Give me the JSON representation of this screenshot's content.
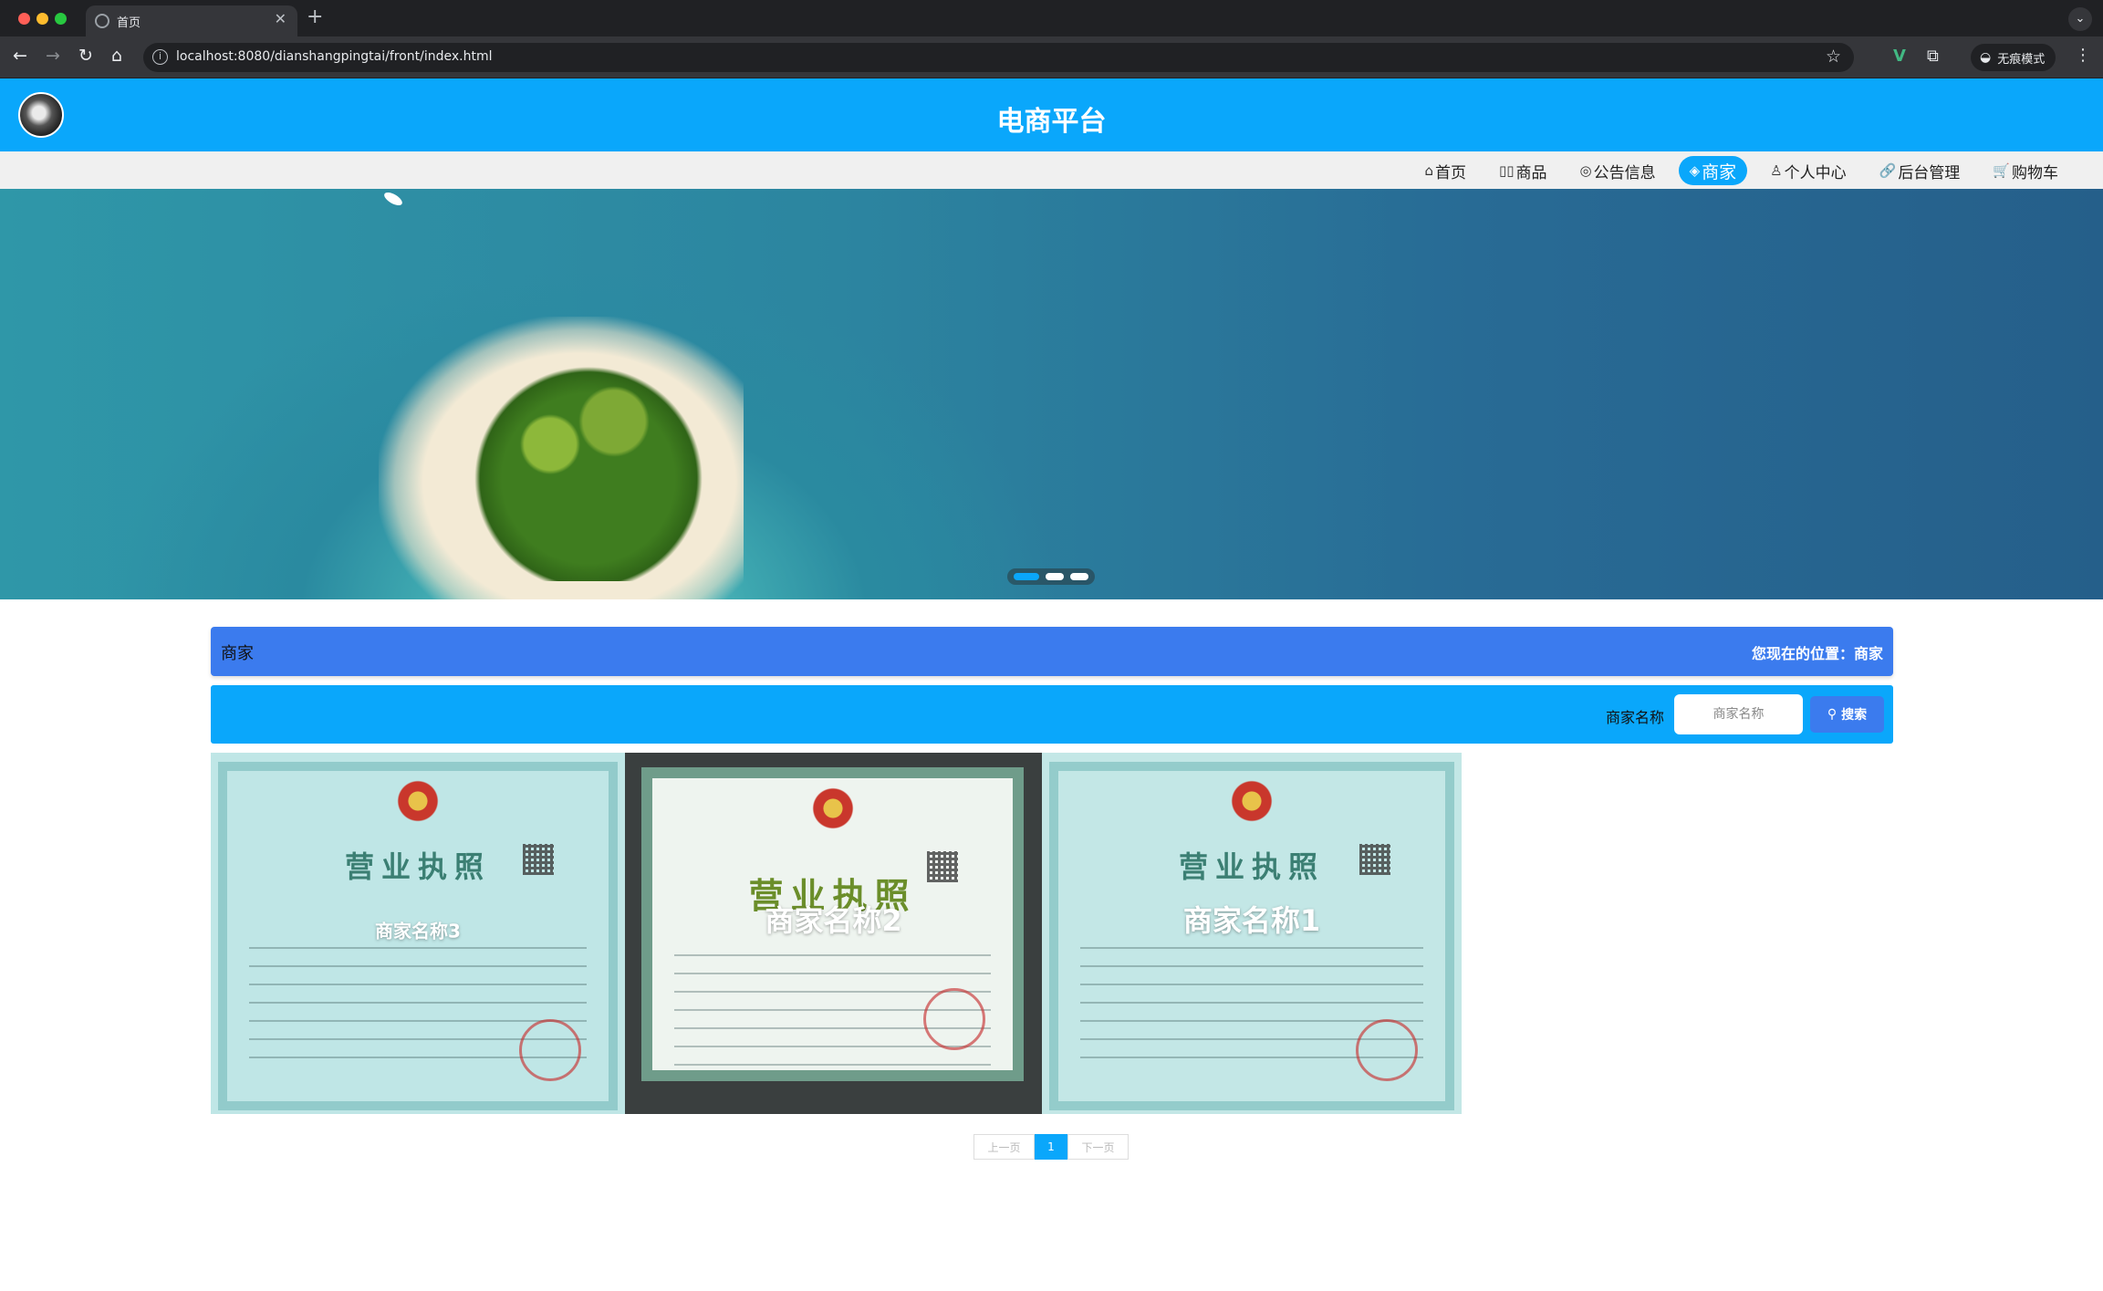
{
  "browser": {
    "tab_title": "首页",
    "tab_close": "✕",
    "new_tab": "+",
    "url": "localhost:8080/dianshangpingtai/front/index.html",
    "incognito_label": "无痕模式",
    "icons": [
      "back-icon",
      "forward-icon",
      "reload-icon",
      "home-icon",
      "info-icon",
      "star-icon",
      "vue-devtools-icon",
      "extensions-icon",
      "incognito-icon",
      "menu-icon"
    ]
  },
  "header": {
    "title": "电商平台"
  },
  "nav": {
    "items": [
      {
        "icon": "⌂",
        "label": "首页"
      },
      {
        "icon": "▯▯",
        "label": "商品"
      },
      {
        "icon": "◎",
        "label": "公告信息"
      },
      {
        "icon": "◈",
        "label": "商家",
        "active": true
      },
      {
        "icon": "♙",
        "label": "个人中心"
      },
      {
        "icon": "🔗",
        "label": "后台管理"
      },
      {
        "icon": "🛒",
        "label": "购物车"
      }
    ]
  },
  "banner": {
    "slide_count": 3,
    "active_slide": 1
  },
  "breadcrumb": {
    "title": "商家",
    "location": "您现在的位置：商家"
  },
  "search": {
    "label": "商家名称",
    "placeholder": "商家名称",
    "button_label": "搜索"
  },
  "merchants": [
    {
      "name": "商家名称3",
      "heading": "营业执照"
    },
    {
      "name": "商家名称2",
      "heading": "营业执照"
    },
    {
      "name": "商家名称1",
      "heading": "营业执照"
    }
  ],
  "pagination": {
    "prev": "上一页",
    "current": "1",
    "next": "下一页"
  },
  "colors": {
    "primary": "#0aa7fb",
    "accent": "#3b7bee"
  }
}
